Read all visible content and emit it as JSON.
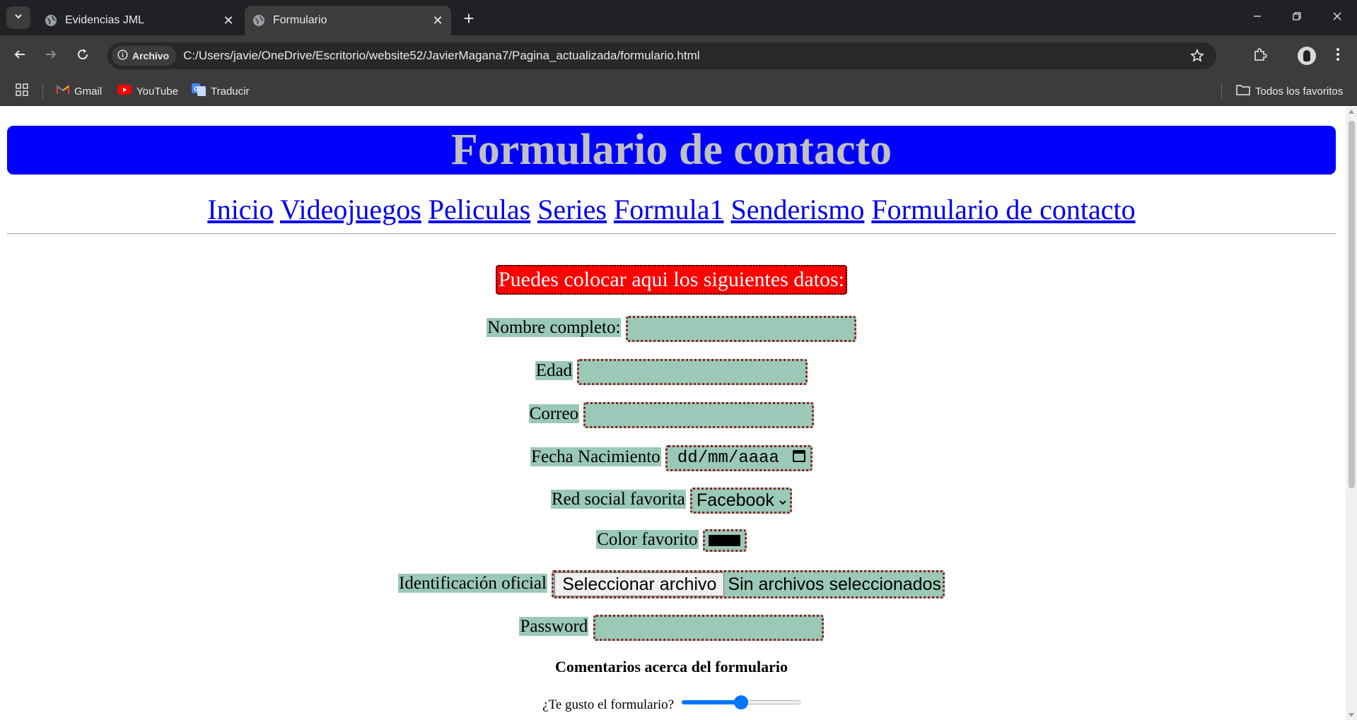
{
  "browser": {
    "tabs": [
      {
        "title": "Evidencias JML",
        "active": false
      },
      {
        "title": "Formulario",
        "active": true
      }
    ],
    "chip_label": "Archivo",
    "url": "C:/Users/javie/OneDrive/Escritorio/website52/JavierMagana7/Pagina_actualizada/formulario.html",
    "bookmarks": [
      {
        "label": "Gmail",
        "icon": "gmail-icon"
      },
      {
        "label": "YouTube",
        "icon": "youtube-icon"
      },
      {
        "label": "Traducir",
        "icon": "translate-icon"
      }
    ],
    "all_bookmarks_label": "Todos los favoritos"
  },
  "page": {
    "title": "Formulario de contacto",
    "nav": [
      "Inicio",
      "Videojuegos",
      "Peliculas",
      "Series",
      "Formula1",
      "Senderismo",
      "Formulario de contacto"
    ],
    "banner": "Puedes colocar aqui los siguientes datos:",
    "form": {
      "name_label": "Nombre completo:",
      "age_label": "Edad",
      "email_label": "Correo",
      "birth_label": "Fecha Nacimiento",
      "birth_placeholder": "dd/mm/aaaa",
      "social_label": "Red social favorita",
      "social_selected": "Facebook",
      "color_label": "Color favorito",
      "color_value": "#000000",
      "id_label": "Identificación oficial",
      "file_button": "Seleccionar archivo",
      "file_status": "Sin archivos seleccionados",
      "password_label": "Password"
    },
    "comments_heading": "Comentarios acerca del formulario",
    "rating_label": "¿Te gusto el formulario?",
    "rating_value": 0.5
  },
  "colors": {
    "header_bg": "#0000ff",
    "header_text": "#c0c0c0",
    "banner_bg": "#ff0000",
    "field_bg": "#9bc9b7",
    "field_border": "#8b2020",
    "slider_accent": "#0075ff"
  }
}
